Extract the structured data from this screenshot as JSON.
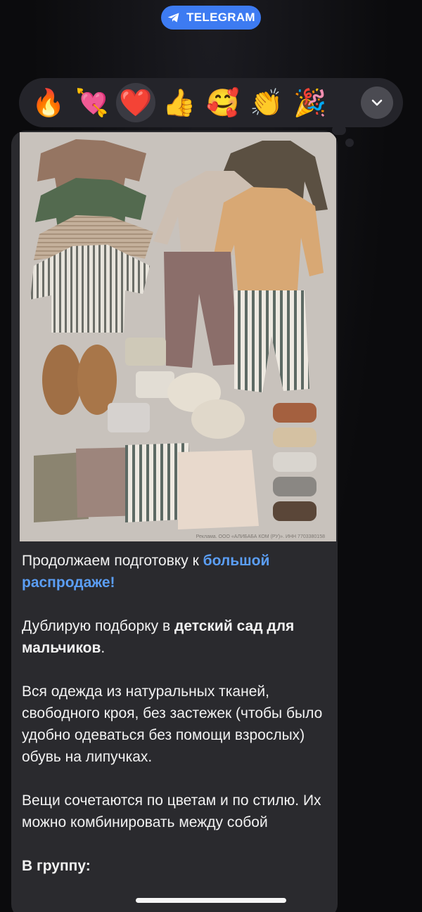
{
  "top_pill": {
    "label": "TELEGRAM",
    "color": "#3d7bf2",
    "icon": "telegram-plane-icon"
  },
  "reactions": [
    {
      "emoji": "🔥",
      "name": "fire"
    },
    {
      "emoji": "💘",
      "name": "heart-arrow"
    },
    {
      "emoji": "❤️",
      "name": "red-heart",
      "selected": true
    },
    {
      "emoji": "👍",
      "name": "thumbs-up"
    },
    {
      "emoji": "🥰",
      "name": "smiling-hearts"
    },
    {
      "emoji": "👏",
      "name": "clapping"
    },
    {
      "emoji": "🎉",
      "name": "party-popper"
    }
  ],
  "reactions_more_icon": "chevron-down-icon",
  "post": {
    "photo_caption": "Реклама. ООО «АЛИБАБА КОМ (РУ)». ИНН 7703380158",
    "p1_text": "Продолжаем подготовку к ",
    "p1_link": "большой распродаже!",
    "p2_text": "Дублирую подборку в ",
    "p2_bold": "детский сад для мальчиков",
    "p2_end": ".",
    "p3_line1": "Вся одежда из натуральных тканей, свободного кроя, без застежек (чтобы было удобно одеваться без помощи взрослых)",
    "p3_line2": "обувь на липучках.",
    "p4": "Вещи сочетаются по цветам и по стилю. Их можно комбинировать между собой",
    "p5_bold": "В группу:"
  }
}
